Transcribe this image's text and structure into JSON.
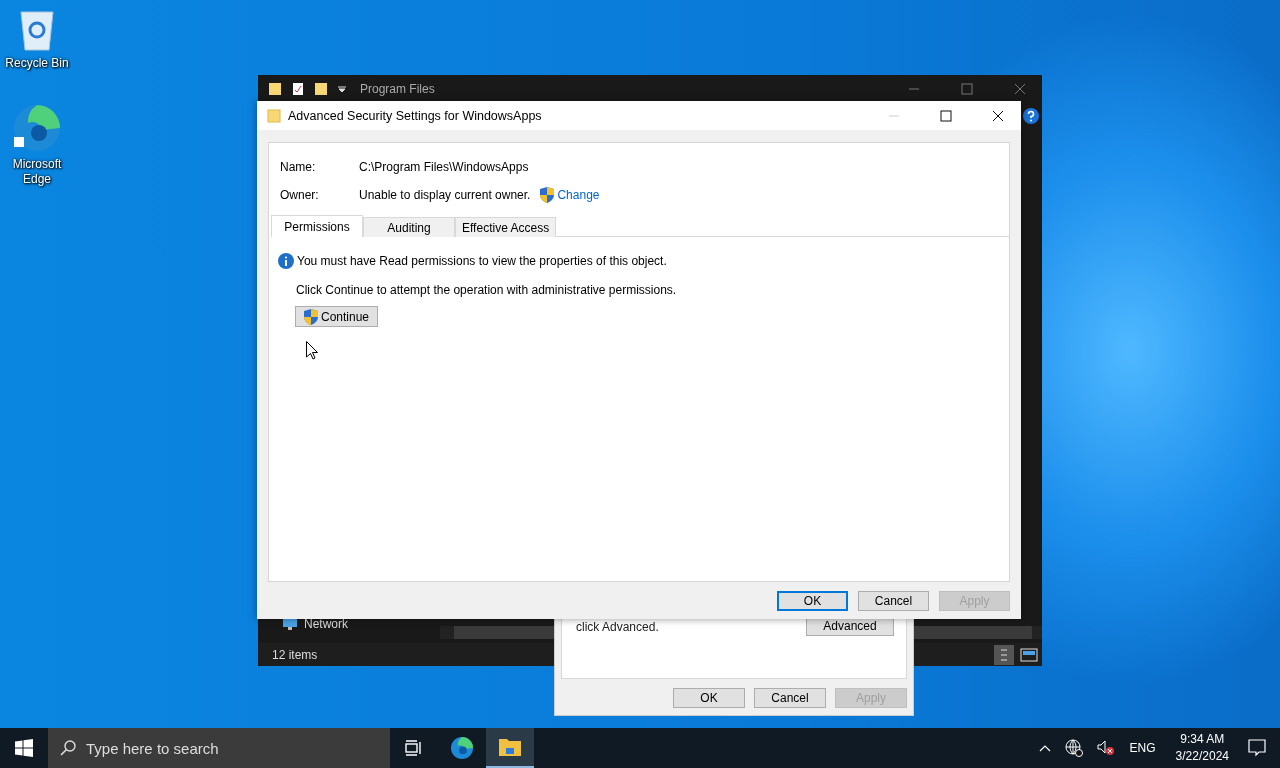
{
  "desktop_icons": [
    {
      "label": "Recycle Bin",
      "kind": "recycle"
    },
    {
      "label": "Microsoft Edge",
      "kind": "edge"
    }
  ],
  "explorer": {
    "title": "Program Files",
    "nav_item": "Network",
    "status": "12 items"
  },
  "properties_dialog": {
    "note": "click Advanced.",
    "advanced_button": "Advanced",
    "buttons": [
      {
        "label": "OK",
        "disabled": false
      },
      {
        "label": "Cancel",
        "disabled": false
      },
      {
        "label": "Apply",
        "disabled": true
      }
    ]
  },
  "security_dialog": {
    "title": "Advanced Security Settings for WindowsApps",
    "fields": [
      {
        "label": "Name:",
        "value": "C:\\Program Files\\WindowsApps"
      },
      {
        "label": "Owner:",
        "value": "Unable to display current owner.",
        "link": "Change"
      }
    ],
    "tabs": [
      {
        "label": "Permissions",
        "selected": true
      },
      {
        "label": "Auditing",
        "selected": false
      },
      {
        "label": "Effective Access",
        "selected": false
      }
    ],
    "info": "You must have Read permissions to view the properties of this object.",
    "prompt": "Click Continue to attempt the operation with administrative permissions.",
    "continue_button": "Continue",
    "buttons": [
      {
        "label": "OK",
        "disabled": false,
        "default": true
      },
      {
        "label": "Cancel",
        "disabled": false,
        "default": false
      },
      {
        "label": "Apply",
        "disabled": true,
        "default": false
      }
    ]
  },
  "taskbar": {
    "search_placeholder": "Type here to search",
    "apps": [
      {
        "kind": "taskview",
        "selected": false
      },
      {
        "kind": "edge",
        "selected": false
      },
      {
        "kind": "explorer",
        "selected": true
      }
    ],
    "language": "ENG",
    "time": "9:34 AM",
    "date": "3/22/2024"
  }
}
